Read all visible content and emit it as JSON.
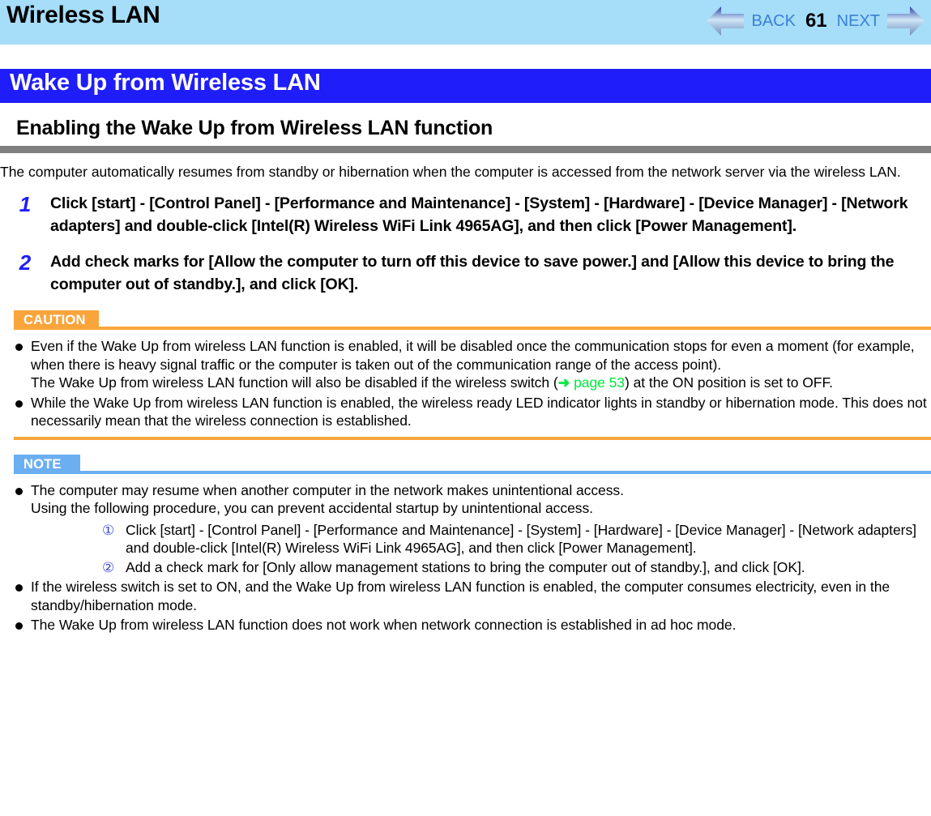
{
  "header": {
    "title": "Wireless LAN",
    "nav": {
      "back_label": "BACK",
      "page_number": "61",
      "next_label": "NEXT",
      "back_arrow_icon": "arrow-left-icon",
      "next_arrow_icon": "arrow-right-icon"
    },
    "background_color": "#a6ddf9"
  },
  "section": {
    "title": "Wake Up from Wireless LAN",
    "background_color": "#1f1df9"
  },
  "subheading": {
    "title": "Enabling the Wake Up from Wireless LAN function",
    "rule_color": "#808080"
  },
  "intro": "The computer automatically resumes from standby or hibernation when the computer is accessed from the network server via the wireless LAN.",
  "steps": [
    {
      "number": "1",
      "text": "Click [start] - [Control Panel] - [Performance and Maintenance] - [System] - [Hardware] - [Device Manager] - [Network adapters] and double-click [Intel(R) Wireless WiFi Link 4965AG], and then click [Power Management]."
    },
    {
      "number": "2",
      "text": "Add check marks for [Allow the computer to turn off this device to save power.] and [Allow this device to bring the computer out of standby.], and click [OK]."
    }
  ],
  "caution": {
    "badge_label": "CAUTION",
    "accent_color": "#faa43c",
    "bullets": {
      "b1_part1": "Even if the Wake Up from wireless LAN function is enabled, it will be disabled once the communication stops for even a moment (for example, when there is heavy signal traffic or the computer is taken out of the communication range of the access point).",
      "b1_part2_pre": "The Wake Up from wireless LAN function will also be disabled if the wireless switch (",
      "b1_link_arrow": "➜",
      "b1_link_text": "page 53",
      "b1_part2_post": ") at the ON position is set to OFF.",
      "b2": "While the Wake Up from wireless LAN function is enabled, the wireless ready LED indicator lights in standby or hibernation mode. This does not necessarily mean that the wireless connection is established."
    }
  },
  "note": {
    "badge_label": "NOTE",
    "accent_color": "#6baff0",
    "bullet1_line1": "The computer may resume when another computer in the network makes unintentional access.",
    "bullet1_line2": "Using the following procedure, you can prevent accidental startup by unintentional access.",
    "substeps": [
      {
        "marker": "①",
        "text": "Click [start] - [Control Panel] - [Performance and Maintenance] - [System] - [Hardware] - [Device Manager] - [Network adapters] and double-click [Intel(R) Wireless WiFi Link 4965AG], and then click [Power Management]."
      },
      {
        "marker": "②",
        "text": "Add a check mark for [Only allow management stations to bring the computer out of standby.], and click [OK]."
      }
    ],
    "bullet2": "If the wireless switch is set to ON, and the Wake Up from wireless LAN function is enabled, the computer consumes electricity, even in the standby/hibernation mode.",
    "bullet3": "The Wake Up from wireless LAN function does not work when network connection is established in ad hoc mode."
  }
}
